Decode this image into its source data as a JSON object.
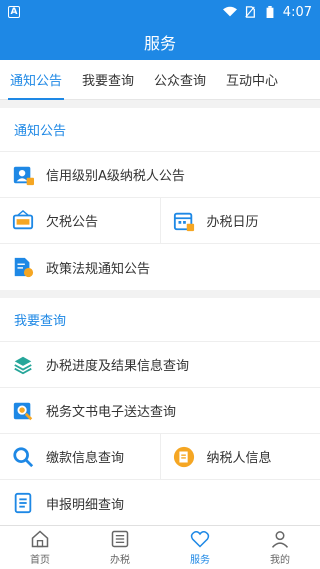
{
  "status": {
    "left_glyph": "A",
    "time": "4:07"
  },
  "title": "服务",
  "tabs": [
    {
      "label": "通知公告",
      "active": true
    },
    {
      "label": "我要查询",
      "active": false
    },
    {
      "label": "公众查询",
      "active": false
    },
    {
      "label": "互动中心",
      "active": false
    }
  ],
  "sections": {
    "notices": {
      "title": "通知公告",
      "items": {
        "a_level": {
          "label": "信用级别A级纳税人公告",
          "icon": "person-badge-icon"
        },
        "arrears": {
          "label": "欠税公告",
          "icon": "arrears-sign-icon"
        },
        "calendar": {
          "label": "办税日历",
          "icon": "calendar-icon"
        },
        "policy": {
          "label": "政策法规通知公告",
          "icon": "document-star-icon"
        }
      }
    },
    "query": {
      "title": "我要查询",
      "items": {
        "progress": {
          "label": "办税进度及结果信息查询",
          "icon": "layers-icon"
        },
        "docs": {
          "label": "税务文书电子送达查询",
          "icon": "search-document-icon"
        },
        "payment": {
          "label": "缴款信息查询",
          "icon": "magnifier-icon"
        },
        "taxpayer": {
          "label": "纳税人信息",
          "icon": "taxpayer-card-icon"
        },
        "declaration": {
          "label": "申报明细查询",
          "icon": "list-document-icon"
        }
      }
    }
  },
  "bottom_nav": [
    {
      "label": "首页",
      "icon": "home-icon",
      "active": false
    },
    {
      "label": "办税",
      "icon": "list-icon",
      "active": false
    },
    {
      "label": "服务",
      "icon": "heart-icon",
      "active": true
    },
    {
      "label": "我的",
      "icon": "user-icon",
      "active": false
    }
  ],
  "colors": {
    "primary": "#1e88e5",
    "orange": "#f5a623",
    "text": "#333333"
  }
}
